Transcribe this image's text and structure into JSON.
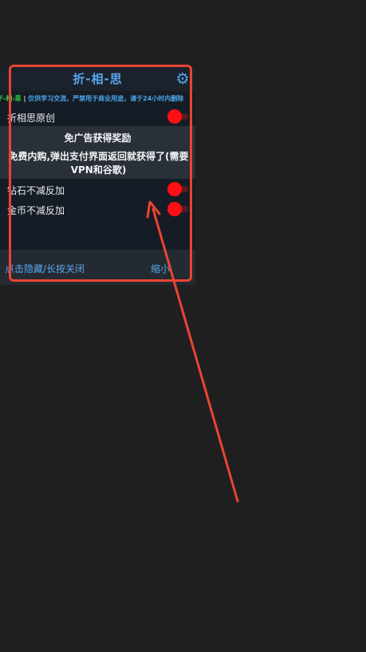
{
  "menu": {
    "title": "折-相-思",
    "notice_brand": "于-相-思",
    "notice_sep": "|",
    "notice_text": "仅供学习交流，严禁用于商业用途，请于24小时内删除",
    "toggles": [
      {
        "label": "折相思原创",
        "state": "on"
      },
      {
        "label": "钻石不减反加",
        "state": "on"
      },
      {
        "label": "金币不减反加",
        "state": "on"
      }
    ],
    "section": {
      "title": "免广告获得奖励",
      "description": "免费内购,弹出支付界面返回就获得了(需要VPN和谷歌)"
    },
    "footer": {
      "hide_close_label": "点击隐藏/长按关闭",
      "minimize_label": "缩小"
    }
  },
  "colors": {
    "background": "#1f1f1f",
    "panel": "#161c25",
    "accent_blue": "#5aa5ec",
    "toggle_red": "#ff0f14",
    "annotation_red": "#ea4433"
  },
  "icons": {
    "settings": "gear-icon"
  }
}
